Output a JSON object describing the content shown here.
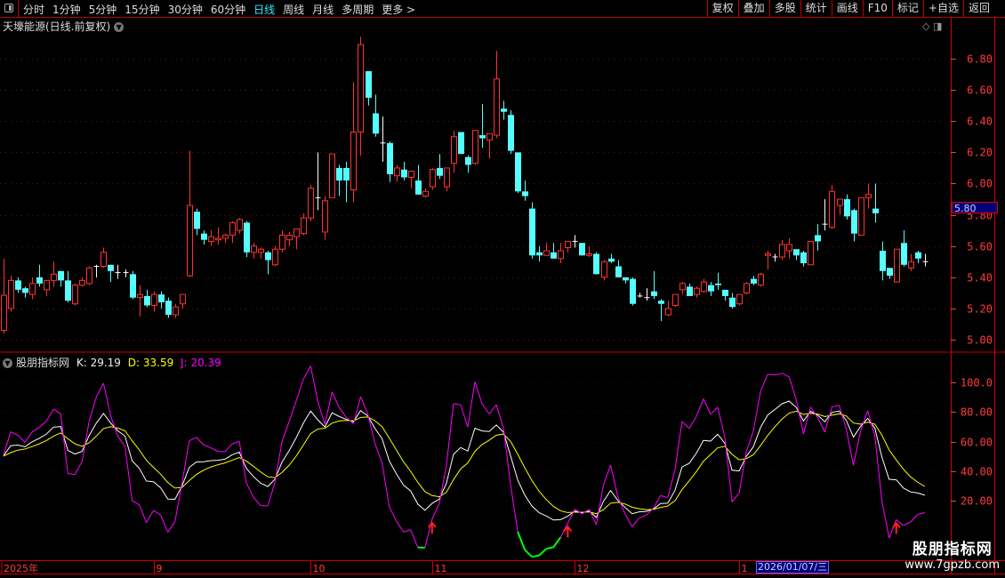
{
  "toolbar": {
    "periods": [
      "分时",
      "1分钟",
      "5分钟",
      "15分钟",
      "30分钟",
      "60分钟",
      "日线",
      "周线",
      "月线",
      "多周期",
      "更多 >"
    ],
    "active_period": "日线",
    "right_buttons": [
      "复权",
      "叠加",
      "多股",
      "统计",
      "画线",
      "F10",
      "标记",
      "+自选",
      "返回"
    ]
  },
  "title": "天壕能源(日线.前复权)",
  "cursor_price": "5.80",
  "cursor_date": "2026/01/07/三",
  "indicator": {
    "name": "股朋指标网",
    "k": "K: 29.19",
    "d": "D: 33.59",
    "j": "J: 20.39"
  },
  "watermark": {
    "line1": "股朋指标网",
    "line2": "www.7gpzb.com"
  },
  "colors": {
    "up": "#ff3333",
    "down": "#55ffff",
    "doji": "#ffffff",
    "k": "#ffffff",
    "d": "#ffff00",
    "j": "#ff00ff",
    "j_negative": "#00ff00",
    "axis": "#ff3b3b",
    "grid": "#8a0000"
  },
  "chart_data": [
    {
      "type": "candlestick",
      "ylim": [
        4.95,
        6.97
      ],
      "yticks": [
        "6.80",
        "6.60",
        "6.40",
        "6.20",
        "6.00",
        "5.80",
        "5.60",
        "5.40",
        "5.20",
        "5.00"
      ],
      "ytick_values": [
        6.8,
        6.6,
        6.4,
        6.2,
        6.0,
        5.8,
        5.6,
        5.4,
        5.2,
        5.0
      ],
      "xlabels": [
        {
          "i": 0,
          "text": "2025年"
        },
        {
          "i": 21,
          "text": "9"
        },
        {
          "i": 43,
          "text": "10"
        },
        {
          "i": 60,
          "text": "11"
        },
        {
          "i": 80,
          "text": "12"
        },
        {
          "i": 103,
          "text": "1"
        }
      ],
      "ohlc": [
        [
          5.06,
          5.52,
          5.04,
          5.285
        ],
        [
          5.2,
          5.41,
          5.18,
          5.38
        ],
        [
          5.38,
          5.4,
          5.3,
          5.32
        ],
        [
          5.33,
          5.34,
          5.27,
          5.3
        ],
        [
          5.29,
          5.4,
          5.26,
          5.36
        ],
        [
          5.4,
          5.48,
          5.34,
          5.36
        ],
        [
          5.32,
          5.38,
          5.28,
          5.38
        ],
        [
          5.38,
          5.5,
          5.34,
          5.42
        ],
        [
          5.44,
          5.44,
          5.34,
          5.38
        ],
        [
          5.38,
          5.44,
          5.24,
          5.25
        ],
        [
          5.23,
          5.36,
          5.22,
          5.35
        ],
        [
          5.35,
          5.4,
          5.34,
          5.38
        ],
        [
          5.36,
          5.47,
          5.35,
          5.46
        ],
        [
          5.47,
          5.48,
          5.4,
          5.47
        ],
        [
          5.47,
          5.59,
          5.46,
          5.56
        ],
        [
          5.48,
          5.48,
          5.37,
          5.44
        ],
        [
          5.43,
          5.48,
          5.39,
          5.43
        ],
        [
          5.43,
          5.45,
          5.4,
          5.43
        ],
        [
          5.42,
          5.44,
          5.26,
          5.27
        ],
        [
          5.27,
          5.35,
          5.15,
          5.29
        ],
        [
          5.28,
          5.32,
          5.21,
          5.22
        ],
        [
          5.22,
          5.31,
          5.18,
          5.29
        ],
        [
          5.29,
          5.31,
          5.2,
          5.24
        ],
        [
          5.25,
          5.27,
          5.14,
          5.16
        ],
        [
          5.16,
          5.23,
          5.14,
          5.21
        ],
        [
          5.23,
          5.29,
          5.2,
          5.29
        ],
        [
          5.41,
          6.21,
          5.4,
          5.86
        ],
        [
          5.82,
          5.84,
          5.67,
          5.71
        ],
        [
          5.68,
          5.7,
          5.61,
          5.64
        ],
        [
          5.63,
          5.7,
          5.6,
          5.66
        ],
        [
          5.64,
          5.72,
          5.61,
          5.65
        ],
        [
          5.65,
          5.68,
          5.62,
          5.67
        ],
        [
          5.67,
          5.76,
          5.62,
          5.75
        ],
        [
          5.7,
          5.78,
          5.68,
          5.77
        ],
        [
          5.75,
          5.76,
          5.53,
          5.56
        ],
        [
          5.56,
          5.62,
          5.52,
          5.6
        ],
        [
          5.56,
          5.59,
          5.52,
          5.58
        ],
        [
          5.56,
          5.57,
          5.42,
          5.51
        ],
        [
          5.48,
          5.6,
          5.47,
          5.58
        ],
        [
          5.58,
          5.7,
          5.56,
          5.67
        ],
        [
          5.64,
          5.69,
          5.6,
          5.67
        ],
        [
          5.66,
          5.71,
          5.58,
          5.71
        ],
        [
          5.68,
          5.81,
          5.67,
          5.78
        ],
        [
          5.78,
          5.99,
          5.76,
          5.97
        ],
        [
          5.91,
          6.2,
          5.83,
          5.91
        ],
        [
          5.69,
          5.92,
          5.64,
          5.89
        ],
        [
          5.91,
          6.19,
          5.91,
          6.19
        ],
        [
          6.1,
          6.12,
          5.92,
          6.02
        ],
        [
          6.1,
          6.14,
          5.88,
          6.02
        ],
        [
          5.96,
          6.65,
          5.88,
          6.33
        ],
        [
          6.33,
          6.94,
          6.18,
          6.89
        ],
        [
          6.72,
          6.72,
          6.5,
          6.55
        ],
        [
          6.45,
          6.57,
          6.3,
          6.32
        ],
        [
          6.26,
          6.43,
          6.14,
          6.26
        ],
        [
          6.26,
          6.27,
          6.01,
          6.06
        ],
        [
          6.05,
          6.12,
          6.01,
          6.1
        ],
        [
          6.09,
          6.14,
          6.02,
          6.04
        ],
        [
          6.04,
          6.08,
          5.97,
          6.08
        ],
        [
          6.02,
          6.12,
          5.93,
          5.93
        ],
        [
          5.92,
          5.97,
          5.91,
          5.95
        ],
        [
          5.98,
          6.1,
          5.96,
          6.09
        ],
        [
          6.1,
          6.19,
          6.03,
          6.05
        ],
        [
          5.98,
          6.1,
          5.95,
          6.1
        ],
        [
          6.13,
          6.34,
          6.07,
          6.3
        ],
        [
          6.33,
          6.33,
          6.19,
          6.19
        ],
        [
          6.17,
          6.18,
          6.07,
          6.12
        ],
        [
          6.13,
          6.34,
          6.12,
          6.34
        ],
        [
          6.31,
          6.51,
          6.23,
          6.29
        ],
        [
          6.28,
          6.32,
          6.16,
          6.32
        ],
        [
          6.31,
          6.85,
          6.29,
          6.67
        ],
        [
          6.48,
          6.53,
          6.41,
          6.46
        ],
        [
          6.44,
          6.47,
          6.19,
          6.21
        ],
        [
          6.2,
          6.2,
          5.94,
          5.95
        ],
        [
          5.95,
          6.02,
          5.89,
          5.92
        ],
        [
          5.84,
          5.88,
          5.52,
          5.54
        ],
        [
          5.56,
          5.6,
          5.5,
          5.54
        ],
        [
          5.54,
          5.62,
          5.54,
          5.57
        ],
        [
          5.56,
          5.62,
          5.52,
          5.52
        ],
        [
          5.52,
          5.62,
          5.49,
          5.57
        ],
        [
          5.59,
          5.63,
          5.56,
          5.63
        ],
        [
          5.63,
          5.67,
          5.59,
          5.63
        ],
        [
          5.62,
          5.62,
          5.54,
          5.54
        ],
        [
          5.54,
          5.6,
          5.53,
          5.55
        ],
        [
          5.55,
          5.56,
          5.42,
          5.42
        ],
        [
          5.4,
          5.51,
          5.38,
          5.5
        ],
        [
          5.52,
          5.55,
          5.49,
          5.5
        ],
        [
          5.47,
          5.51,
          5.4,
          5.4
        ],
        [
          5.4,
          5.4,
          5.36,
          5.38
        ],
        [
          5.39,
          5.4,
          5.22,
          5.23
        ],
        [
          5.28,
          5.3,
          5.27,
          5.28
        ],
        [
          5.27,
          5.33,
          5.25,
          5.27
        ],
        [
          5.31,
          5.44,
          5.26,
          5.28
        ],
        [
          5.25,
          5.26,
          5.12,
          5.23
        ],
        [
          5.16,
          5.25,
          5.15,
          5.2
        ],
        [
          5.22,
          5.29,
          5.21,
          5.29
        ],
        [
          5.32,
          5.37,
          5.29,
          5.36
        ],
        [
          5.34,
          5.36,
          5.28,
          5.28
        ],
        [
          5.29,
          5.34,
          5.27,
          5.33
        ],
        [
          5.31,
          5.39,
          5.3,
          5.37
        ],
        [
          5.35,
          5.37,
          5.28,
          5.31
        ],
        [
          5.36,
          5.43,
          5.32,
          5.35
        ],
        [
          5.32,
          5.32,
          5.25,
          5.28
        ],
        [
          5.27,
          5.3,
          5.2,
          5.21
        ],
        [
          5.23,
          5.29,
          5.22,
          5.29
        ],
        [
          5.3,
          5.37,
          5.29,
          5.36
        ],
        [
          5.39,
          5.41,
          5.35,
          5.36
        ],
        [
          5.35,
          5.43,
          5.34,
          5.42
        ],
        [
          5.54,
          5.57,
          5.45,
          5.55
        ],
        [
          5.53,
          5.55,
          5.5,
          5.53
        ],
        [
          5.53,
          5.64,
          5.51,
          5.61
        ],
        [
          5.57,
          5.65,
          5.52,
          5.61
        ],
        [
          5.58,
          5.58,
          5.51,
          5.54
        ],
        [
          5.56,
          5.57,
          5.47,
          5.49
        ],
        [
          5.48,
          5.63,
          5.48,
          5.63
        ],
        [
          5.67,
          5.74,
          5.57,
          5.63
        ],
        [
          5.74,
          5.9,
          5.7,
          5.74
        ],
        [
          5.72,
          5.99,
          5.71,
          5.95
        ],
        [
          5.86,
          5.9,
          5.8,
          5.9
        ],
        [
          5.9,
          5.93,
          5.77,
          5.79
        ],
        [
          5.83,
          5.84,
          5.63,
          5.68
        ],
        [
          5.67,
          5.91,
          5.67,
          5.91
        ],
        [
          5.91,
          6.0,
          5.84,
          5.93
        ],
        [
          5.84,
          6.0,
          5.75,
          5.81
        ],
        [
          5.57,
          5.63,
          5.38,
          5.44
        ],
        [
          5.46,
          5.46,
          5.39,
          5.41
        ],
        [
          5.37,
          5.58,
          5.37,
          5.58
        ],
        [
          5.62,
          5.7,
          5.47,
          5.48
        ],
        [
          5.46,
          5.55,
          5.44,
          5.5
        ],
        [
          5.56,
          5.57,
          5.49,
          5.52
        ],
        [
          5.5,
          5.55,
          5.47,
          5.5
        ]
      ]
    },
    {
      "type": "line",
      "title": "股朋指标网 KDJ",
      "series": [
        {
          "name": "K"
        },
        {
          "name": "D"
        },
        {
          "name": "J"
        }
      ],
      "params": [
        9,
        3,
        3
      ],
      "ylim": [
        -20,
        115
      ],
      "yticks": [
        "100.0",
        "80.00",
        "60.00",
        "40.00",
        "20.00"
      ],
      "ytick_values": [
        100,
        80,
        60,
        40,
        20
      ],
      "last": {
        "K": 29.19,
        "D": 33.59,
        "J": 20.39
      },
      "buy_arrow_indices": [
        60,
        79,
        125
      ]
    }
  ]
}
